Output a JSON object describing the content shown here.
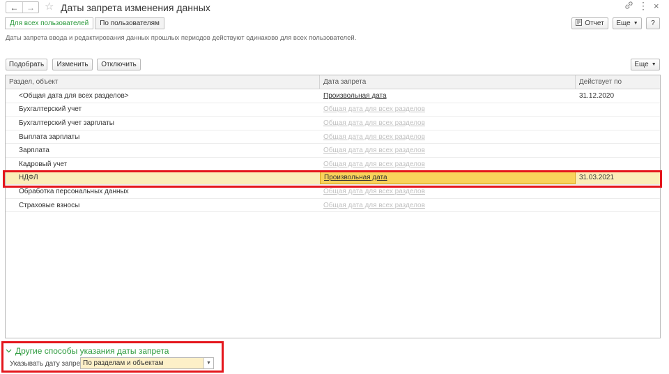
{
  "window": {
    "title": "Даты запрета изменения данных",
    "back_icon": "←",
    "forward_icon": "→",
    "star_icon": "☆",
    "link_icon": "🔗",
    "more_icon": "⋮",
    "close_icon": "×"
  },
  "tabs": [
    {
      "label": "Для всех пользователей",
      "active": true
    },
    {
      "label": "По пользователям",
      "active": false
    }
  ],
  "toolbar": {
    "report_label": "Отчет",
    "more_label": "Еще",
    "help_label": "?"
  },
  "description": "Даты запрета ввода и редактирования данных прошлых периодов действуют одинаково для всех пользователей.",
  "list_toolbar": {
    "select_label": "Подобрать",
    "edit_label": "Изменить",
    "disable_label": "Отключить",
    "more_label": "Еще"
  },
  "table": {
    "columns": [
      "Раздел, объект",
      "Дата запрета",
      "Действует по"
    ],
    "rows": [
      {
        "name": "<Общая дата для всех разделов>",
        "date": "Произвольная дата",
        "until": "31.12.2020",
        "muted": false,
        "selected": false
      },
      {
        "name": "Бухгалтерский учет",
        "date": "Общая дата для всех разделов",
        "until": "",
        "muted": true,
        "selected": false
      },
      {
        "name": "Бухгалтерский учет зарплаты",
        "date": "Общая дата для всех разделов",
        "until": "",
        "muted": true,
        "selected": false
      },
      {
        "name": "Выплата зарплаты",
        "date": "Общая дата для всех разделов",
        "until": "",
        "muted": true,
        "selected": false
      },
      {
        "name": "Зарплата",
        "date": "Общая дата для всех разделов",
        "until": "",
        "muted": true,
        "selected": false
      },
      {
        "name": "Кадровый учет",
        "date": "Общая дата для всех разделов",
        "until": "",
        "muted": true,
        "selected": false
      },
      {
        "name": "НДФЛ",
        "date": "Произвольная дата",
        "until": "31.03.2021",
        "muted": false,
        "selected": true
      },
      {
        "name": "Обработка персональных данных",
        "date": "Общая дата для всех разделов",
        "until": "",
        "muted": true,
        "selected": false
      },
      {
        "name": "Страховые взносы",
        "date": "Общая дата для всех разделов",
        "until": "",
        "muted": true,
        "selected": false
      }
    ]
  },
  "other_methods": {
    "title": "Другие способы указания даты запрета",
    "field_label": "Указывать дату запрета:",
    "field_value": "По разделам и объектам"
  },
  "colors": {
    "accent_green": "#2b9a3c",
    "highlight_red": "#e4161c",
    "selected_row": "#fbeeb8",
    "selected_cell": "#f9d35b"
  }
}
